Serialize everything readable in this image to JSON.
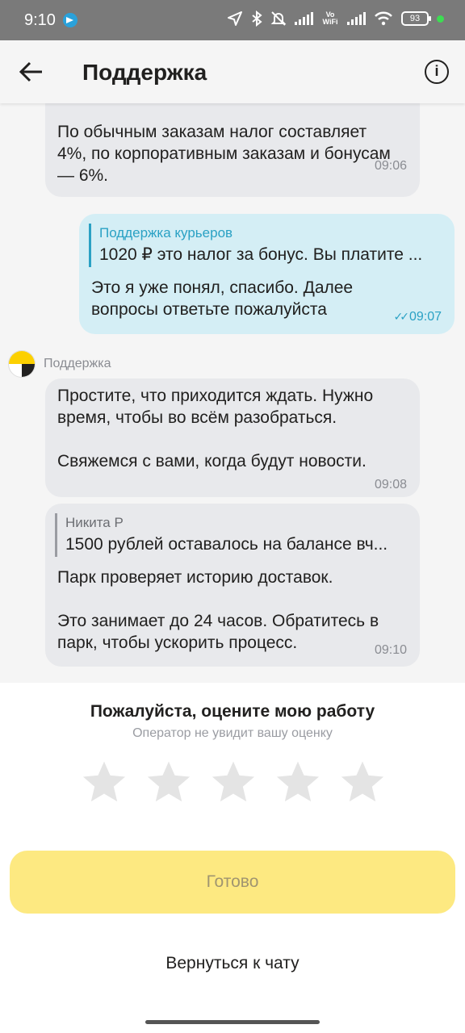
{
  "status_bar": {
    "time": "9:10",
    "network_label": "Vo WiFi",
    "battery": "93"
  },
  "header": {
    "title": "Поддержка",
    "info_label": "i"
  },
  "messages": [
    {
      "text": "По обычным заказам налог составляет 4%, по корпоративным заказам и бонусам — 6%.",
      "time": "09:06"
    },
    {
      "quote_author": "Поддержка курьеров",
      "quote_text": "1020 ₽ это налог за бонус.  Вы платите ...",
      "text": "Это я уже понял, спасибо. Далее вопросы ответьте пожалуйста",
      "time": "09:07"
    },
    {
      "sender": "Поддержка",
      "text1": "Простите, что приходится ждать. Нужно время, чтобы во всём разобраться.",
      "text2": "Свяжемся с вами, когда будут новости.",
      "time": "09:08"
    },
    {
      "quote_author": "Никита Р",
      "quote_text": "1500 рублей оставалось на балансе вч...",
      "text1": "Парк проверяет историю доставок.",
      "text2": "Это занимает до 24 часов. Обратитесь в парк, чтобы ускорить процесс.",
      "time": "09:10"
    }
  ],
  "rating": {
    "title": "Пожалуйста, оцените мою работу",
    "subtitle": "Оператор не увидит вашу оценку",
    "stars_total": 5,
    "stars_selected": 0,
    "done_label": "Готово",
    "back_label": "Вернуться к чату"
  },
  "colors": {
    "accent_yellow": "#fde981",
    "outgoing_bubble": "#d4eef5",
    "incoming_bubble": "#e8e9ec",
    "quote_accent": "#2aa1c4"
  }
}
